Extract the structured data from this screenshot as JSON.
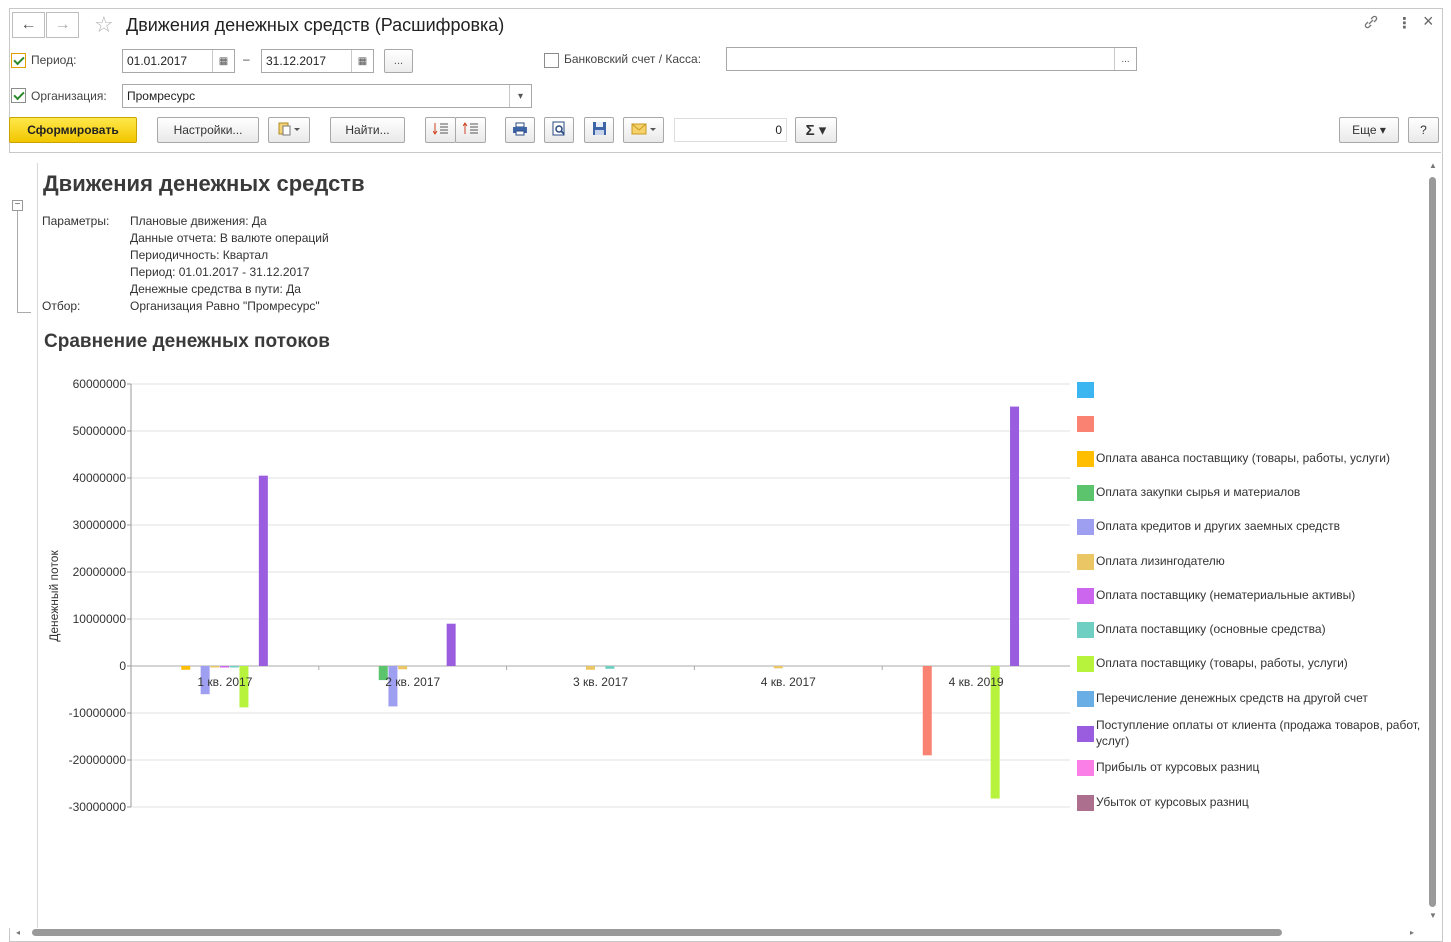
{
  "window": {
    "title": "Движения денежных средств (Расшифровка)",
    "back_icon": "←",
    "forward_icon": "→",
    "star_icon": "☆",
    "link_icon": "🔗",
    "menu_icon": "⋮",
    "close_icon": "×"
  },
  "filters": {
    "period_label": "Период:",
    "period_from": "01.01.2017",
    "period_dash": "–",
    "period_to": "31.12.2017",
    "period_more": "...",
    "bank_label": "Банковский счет / Касса:",
    "bank_value": "",
    "bank_more": "...",
    "org_label": "Организация:",
    "org_value": "Промресурс",
    "org_dropdown": "▾"
  },
  "toolbar": {
    "generate_label": "Сформировать",
    "settings_label": "Настройки...",
    "find_label": "Найти...",
    "sum_value": "0",
    "sigma": "Σ ▾",
    "more_label": "Еще ▾",
    "help_label": "?"
  },
  "report": {
    "title": "Движения денежных средств",
    "params_label": "Параметры:",
    "params": [
      "Плановые движения: Да",
      "Данные отчета: В валюте операций",
      "Периодичность: Квартал",
      "Период: 01.01.2017 - 31.12.2017",
      "Денежные средства в пути: Да"
    ],
    "filter_label": "Отбор:",
    "filter_value": "Организация Равно \"Промресурс\"",
    "chart_title": "Сравнение денежных потоков"
  },
  "chart_data": {
    "type": "bar",
    "ylabel": "Денежный поток",
    "ylim": [
      -30000000,
      60000000
    ],
    "yticks": [
      60000000,
      50000000,
      40000000,
      30000000,
      20000000,
      10000000,
      0,
      -10000000,
      -20000000,
      -30000000
    ],
    "categories": [
      "1 кв. 2017",
      "2 кв. 2017",
      "3 кв. 2017",
      "4 кв. 2017",
      "4 кв. 2019"
    ],
    "series": [
      {
        "name": "",
        "color": "#3bb6f0",
        "values": [
          0,
          0,
          0,
          0,
          0
        ]
      },
      {
        "name": "",
        "color": "#fa8272",
        "values": [
          0,
          0,
          0,
          0,
          -19000000
        ]
      },
      {
        "name": "Оплата аванса поставщику (товары, работы, услуги)",
        "color": "#ffbf00",
        "values": [
          -800000,
          0,
          0,
          0,
          0
        ]
      },
      {
        "name": "Оплата закупки сырья и материалов",
        "color": "#5cc46c",
        "values": [
          0,
          -3000000,
          0,
          0,
          0
        ]
      },
      {
        "name": "Оплата кредитов и других заемных средств",
        "color": "#9f9ff2",
        "values": [
          -6000000,
          -8600000,
          0,
          0,
          0
        ]
      },
      {
        "name": "Оплата лизингодателю",
        "color": "#ebc665",
        "values": [
          -300000,
          -700000,
          -800000,
          -500000,
          0
        ]
      },
      {
        "name": "Оплата поставщику (нематериальные активы)",
        "color": "#cc66ef",
        "values": [
          -200000,
          0,
          0,
          0,
          0
        ]
      },
      {
        "name": "Оплата поставщику (основные средства)",
        "color": "#6fcfc3",
        "values": [
          -200000,
          0,
          -600000,
          0,
          0
        ]
      },
      {
        "name": "Оплата поставщику (товары, работы, услуги)",
        "color": "#b7f23d",
        "values": [
          -8800000,
          0,
          0,
          0,
          -28200000
        ]
      },
      {
        "name": "Перечисление денежных средств на другой счет",
        "color": "#6aaee6",
        "values": [
          0,
          0,
          0,
          0,
          0
        ]
      },
      {
        "name": "Поступление оплаты от клиента (продажа товаров, работ, услуг)",
        "color": "#9a5ddf",
        "values": [
          40500000,
          9000000,
          0,
          0,
          55200000
        ]
      },
      {
        "name": "Прибыль от курсовых разниц",
        "color": "#fa7fe6",
        "values": [
          0,
          0,
          0,
          0,
          0
        ]
      },
      {
        "name": "Убыток от курсовых разниц",
        "color": "#ad6f8e",
        "values": [
          0,
          0,
          0,
          0,
          0
        ]
      }
    ],
    "grid": true,
    "legend_position": "right"
  }
}
